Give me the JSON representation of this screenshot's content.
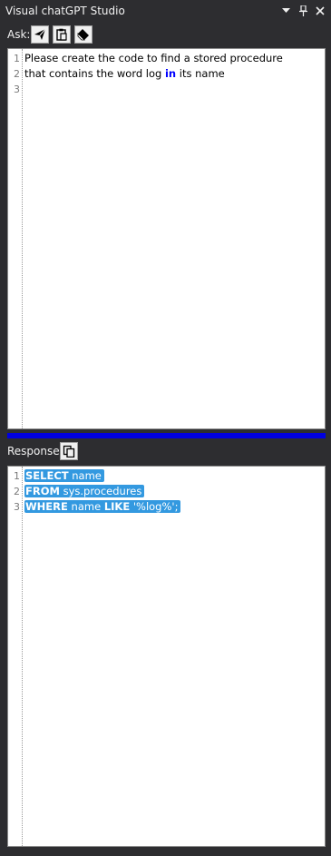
{
  "window": {
    "title": "Visual chatGPT Studio",
    "buttons": [
      "dropdown-icon",
      "pin-icon",
      "close-icon"
    ]
  },
  "ask": {
    "label": "Ask:",
    "buttons": [
      "send-icon",
      "paste-icon",
      "eraser-icon"
    ],
    "lines": [
      {
        "num": "1",
        "parts": [
          {
            "text": "Please create the code to find a stored procedure",
            "kw": false
          }
        ]
      },
      {
        "num": "2",
        "parts": [
          {
            "text": "that contains the word log ",
            "kw": false
          },
          {
            "text": "in",
            "kw": true
          },
          {
            "text": " its name",
            "kw": false
          }
        ]
      },
      {
        "num": "3",
        "parts": []
      }
    ]
  },
  "response": {
    "label": "Response:",
    "buttons": [
      "copy-icon"
    ],
    "lines": [
      {
        "num": "1",
        "parts": [
          {
            "text": "SELECT",
            "kw": true
          },
          {
            "text": " name",
            "kw": false
          }
        ]
      },
      {
        "num": "2",
        "parts": [
          {
            "text": "FROM",
            "kw": true
          },
          {
            "text": " sys.procedures",
            "kw": false
          }
        ]
      },
      {
        "num": "3",
        "parts": [
          {
            "text": "WHERE",
            "kw": true
          },
          {
            "text": " name ",
            "kw": false
          },
          {
            "text": "LIKE",
            "kw": true
          },
          {
            "text": " '%log%';",
            "kw": false
          }
        ]
      }
    ]
  },
  "colors": {
    "background": "#2d2d30",
    "splitter": "#0000e0",
    "selection": "#3399e0",
    "keyword": "#0000ff"
  }
}
